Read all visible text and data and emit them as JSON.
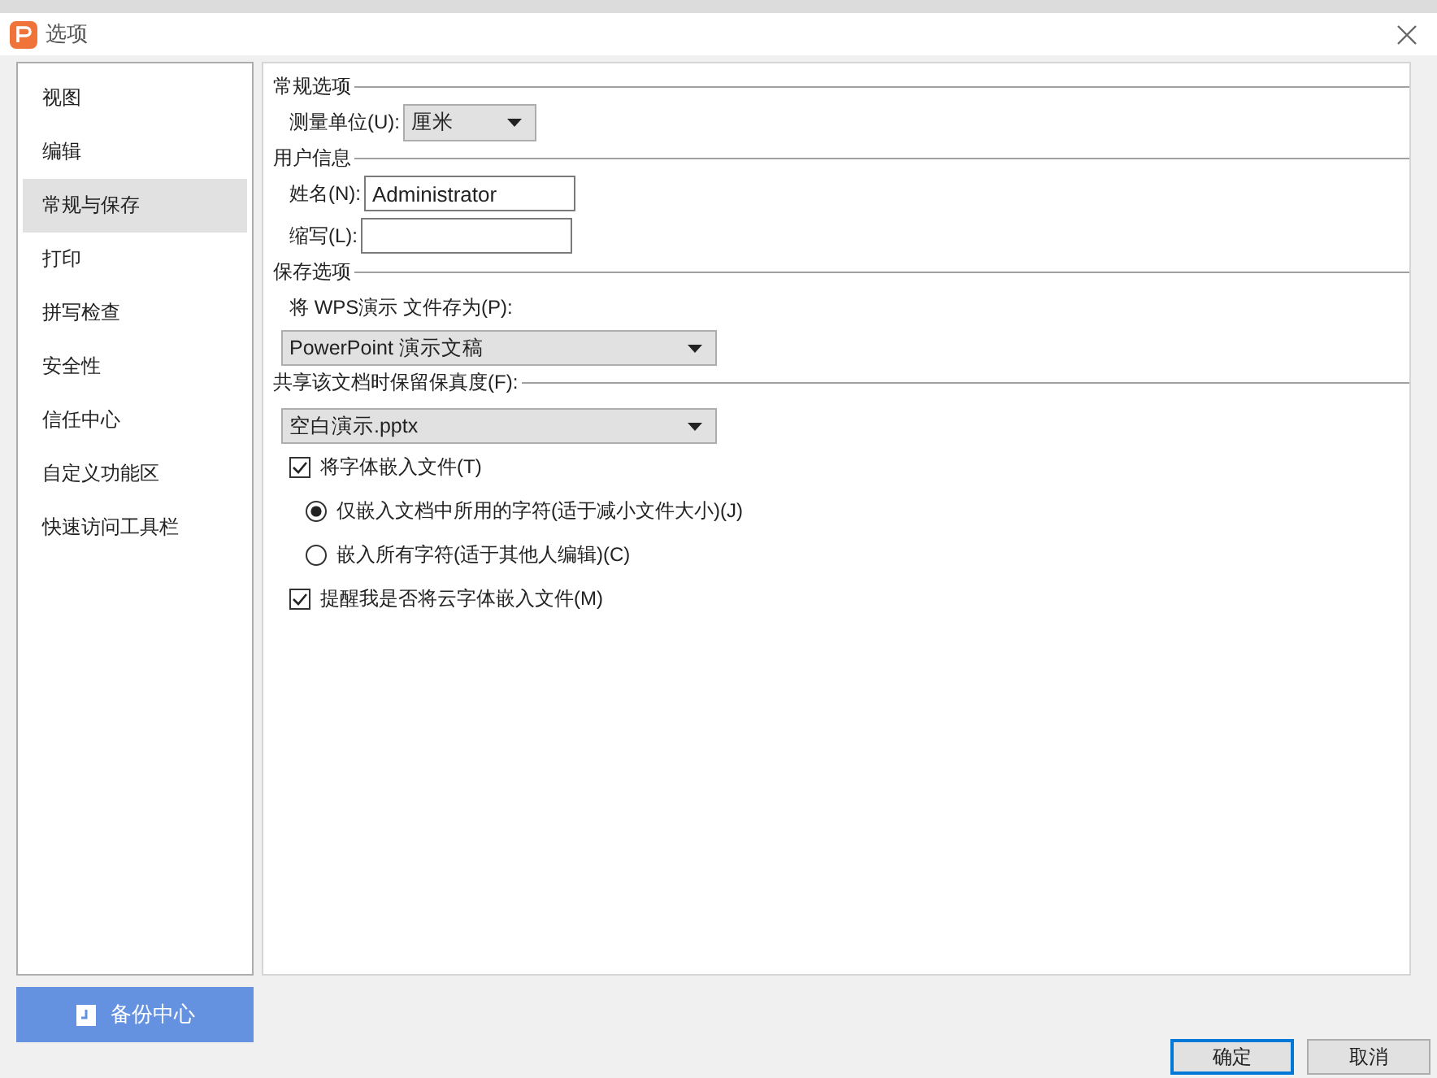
{
  "window": {
    "title": "选项"
  },
  "sidebar": {
    "items": [
      {
        "label": "视图",
        "selected": false
      },
      {
        "label": "编辑",
        "selected": false
      },
      {
        "label": "常规与保存",
        "selected": true
      },
      {
        "label": "打印",
        "selected": false
      },
      {
        "label": "拼写检查",
        "selected": false
      },
      {
        "label": "安全性",
        "selected": false
      },
      {
        "label": "信任中心",
        "selected": false
      },
      {
        "label": "自定义功能区",
        "selected": false
      },
      {
        "label": "快速访问工具栏",
        "selected": false
      }
    ],
    "backup_button": "备份中心"
  },
  "general": {
    "title": "常规选项",
    "unit_label": "测量单位(U):",
    "unit_value": "厘米"
  },
  "user_info": {
    "title": "用户信息",
    "name_label": "姓名(N):",
    "name_value": "Administrator",
    "initials_label": "缩写(L):"
  },
  "save": {
    "title": "保存选项",
    "save_as_label": "将 WPS演示 文件存为(P):",
    "save_as_value": "PowerPoint 演示文稿"
  },
  "fidelity": {
    "title": "共享该文档时保留保真度(F):",
    "file_value": "空白演示.pptx",
    "options": [
      {
        "kind": "checkbox",
        "label": "将字体嵌入文件(T)",
        "checked": true
      },
      {
        "kind": "radio",
        "label": "仅嵌入文档中所用的字符(适于减小文件大小)(J)",
        "selected": true
      },
      {
        "kind": "radio",
        "label": "嵌入所有字符(适于其他人编辑)(C)",
        "selected": false
      },
      {
        "kind": "checkbox",
        "label": "提醒我是否将云字体嵌入文件(M)",
        "checked": true
      }
    ]
  },
  "buttons": [
    "确定",
    "取消"
  ]
}
